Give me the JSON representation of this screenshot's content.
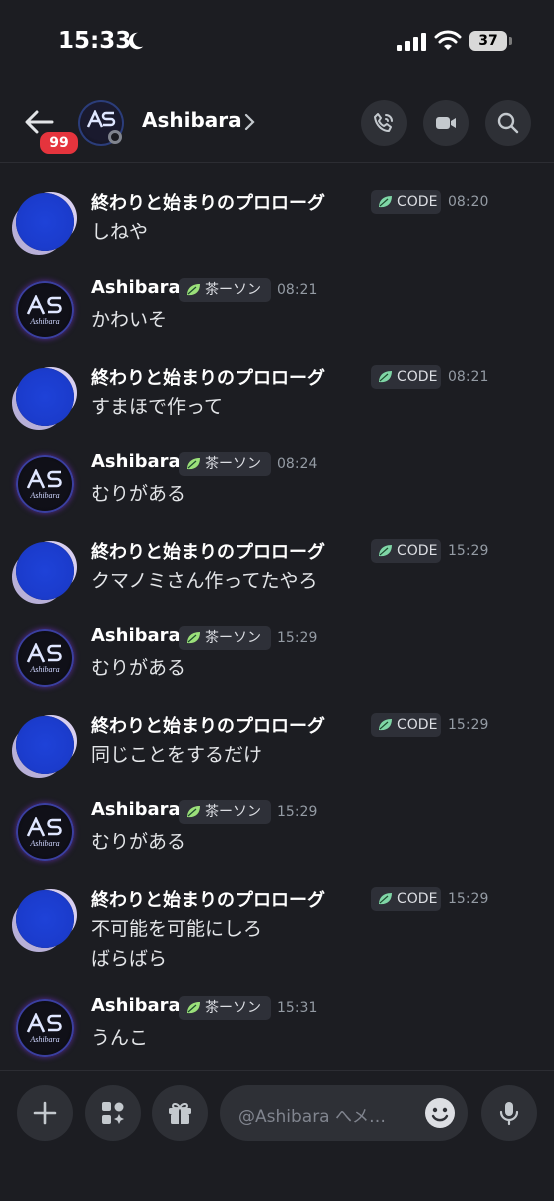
{
  "status_bar": {
    "time": "15:33",
    "battery": "37"
  },
  "header": {
    "unread_count": "99",
    "title": "Ashibara"
  },
  "messages": [
    {
      "author": "終わりと始まりのプロローグ",
      "tag": "CODE",
      "tag_color": "#7fd6a6",
      "time": "08:20",
      "lines": [
        "しねや"
      ],
      "avatar": "blue-avatar"
    },
    {
      "author": "Ashibara",
      "tag": "茶ーソン",
      "tag_color": "#9be07a",
      "time": "08:21",
      "lines": [
        "かわいそ"
      ],
      "avatar": "ashibara-avatar"
    },
    {
      "author": "終わりと始まりのプロローグ",
      "tag": "CODE",
      "tag_color": "#7fd6a6",
      "time": "08:21",
      "lines": [
        "すまほで作って"
      ],
      "avatar": "blue-avatar"
    },
    {
      "author": "Ashibara",
      "tag": "茶ーソン",
      "tag_color": "#9be07a",
      "time": "08:24",
      "lines": [
        "むりがある"
      ],
      "avatar": "ashibara-avatar"
    },
    {
      "author": "終わりと始まりのプロローグ",
      "tag": "CODE",
      "tag_color": "#7fd6a6",
      "time": "15:29",
      "lines": [
        "クマノミさん作ってたやろ"
      ],
      "avatar": "blue-avatar"
    },
    {
      "author": "Ashibara",
      "tag": "茶ーソン",
      "tag_color": "#9be07a",
      "time": "15:29",
      "lines": [
        "むりがある"
      ],
      "avatar": "ashibara-avatar"
    },
    {
      "author": "終わりと始まりのプロローグ",
      "tag": "CODE",
      "tag_color": "#7fd6a6",
      "time": "15:29",
      "lines": [
        "同じことをするだけ"
      ],
      "avatar": "blue-avatar"
    },
    {
      "author": "Ashibara",
      "tag": "茶ーソン",
      "tag_color": "#9be07a",
      "time": "15:29",
      "lines": [
        "むりがある"
      ],
      "avatar": "ashibara-avatar"
    },
    {
      "author": "終わりと始まりのプロローグ",
      "tag": "CODE",
      "tag_color": "#7fd6a6",
      "time": "15:29",
      "lines": [
        "不可能を可能にしろ",
        "ばらばら"
      ],
      "avatar": "blue-avatar"
    },
    {
      "author": "Ashibara",
      "tag": "茶ーソン",
      "tag_color": "#9be07a",
      "time": "15:31",
      "lines": [
        "うんこ"
      ],
      "avatar": "ashibara-avatar"
    }
  ],
  "avatar_logo_text": "Ashibara",
  "composer": {
    "placeholder": "@Ashibara へメ…"
  }
}
